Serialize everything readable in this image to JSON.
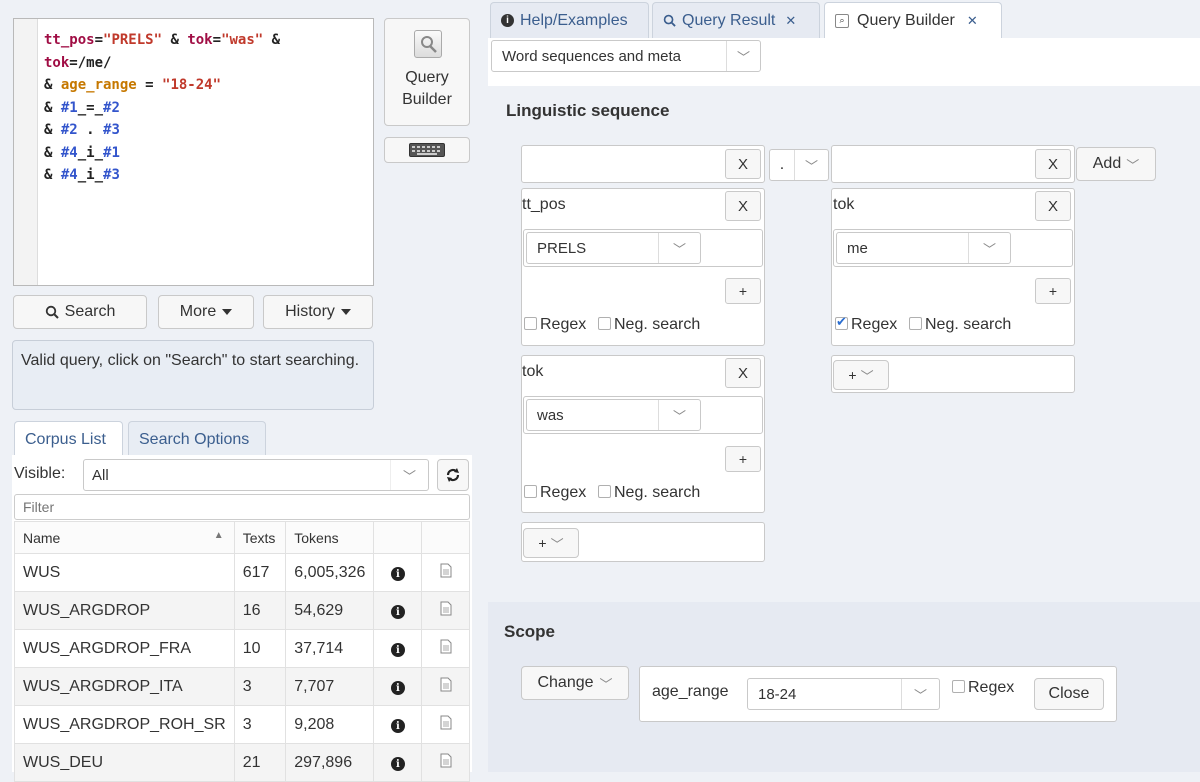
{
  "editor": {
    "lines": [
      {
        "tokens": [
          {
            "t": "tt_pos",
            "c": "k"
          },
          {
            "t": "=",
            "c": "r"
          },
          {
            "t": "\"PRELS\"",
            "c": "s"
          },
          {
            "t": " & ",
            "c": "r"
          },
          {
            "t": "tok",
            "c": "k"
          },
          {
            "t": "=",
            "c": "r"
          },
          {
            "t": "\"was\"",
            "c": "s"
          },
          {
            "t": " &",
            "c": "r"
          }
        ]
      },
      {
        "tokens": [
          {
            "t": "tok",
            "c": "k"
          },
          {
            "t": "=/me/",
            "c": "r"
          }
        ]
      },
      {
        "tokens": [
          {
            "t": "& ",
            "c": "r"
          },
          {
            "t": "age_range",
            "c": "o"
          },
          {
            "t": " = ",
            "c": "r"
          },
          {
            "t": "\"18-24\"",
            "c": "s"
          }
        ]
      },
      {
        "tokens": [
          {
            "t": "& ",
            "c": "r"
          },
          {
            "t": "#1",
            "c": "b"
          },
          {
            "t": "_=_",
            "c": "r"
          },
          {
            "t": "#2",
            "c": "b"
          }
        ]
      },
      {
        "tokens": [
          {
            "t": "& ",
            "c": "r"
          },
          {
            "t": "#2",
            "c": "b"
          },
          {
            "t": " . ",
            "c": "r"
          },
          {
            "t": "#3",
            "c": "b"
          }
        ]
      },
      {
        "tokens": [
          {
            "t": "& ",
            "c": "r"
          },
          {
            "t": "#4",
            "c": "b"
          },
          {
            "t": "_i_",
            "c": "r"
          },
          {
            "t": "#1",
            "c": "b"
          }
        ]
      },
      {
        "tokens": [
          {
            "t": "& ",
            "c": "r"
          },
          {
            "t": "#4",
            "c": "b"
          },
          {
            "t": "_i_",
            "c": "r"
          },
          {
            "t": "#3",
            "c": "b"
          }
        ]
      }
    ]
  },
  "toolbar": {
    "query_builder_line1": "Query",
    "query_builder_line2": "Builder",
    "search": "Search",
    "more": "More",
    "history": "History"
  },
  "status_message": "Valid query, click on \"Search\" to start searching.",
  "left_tabs": [
    "Corpus List",
    "Search Options"
  ],
  "corpus_list": {
    "visible_label": "Visible:",
    "visible_value": "All",
    "filter_placeholder": "Filter",
    "columns": [
      "Name",
      "Texts",
      "Tokens"
    ],
    "rows": [
      {
        "name": "WUS",
        "texts": "617",
        "tokens": "6,005,326"
      },
      {
        "name": "WUS_ARGDROP",
        "texts": "16",
        "tokens": "54,629"
      },
      {
        "name": "WUS_ARGDROP_FRA",
        "texts": "10",
        "tokens": "37,714"
      },
      {
        "name": "WUS_ARGDROP_ITA",
        "texts": "3",
        "tokens": "7,707"
      },
      {
        "name": "WUS_ARGDROP_ROH_SR",
        "texts": "3",
        "tokens": "9,208"
      },
      {
        "name": "WUS_DEU",
        "texts": "21",
        "tokens": "297,896"
      }
    ]
  },
  "right_tabs": [
    {
      "label": "Help/Examples",
      "icon": "info-icon",
      "closable": false
    },
    {
      "label": "Query Result",
      "icon": "search-icon",
      "closable": true
    },
    {
      "label": "Query Builder",
      "icon": "builder-icon",
      "closable": true
    }
  ],
  "builder_mode": "Word sequences and meta",
  "linguistic": {
    "heading": "Linguistic sequence",
    "operator": ".",
    "x": "X",
    "add": "Add",
    "plus": "+",
    "regex": "Regex",
    "neg": "Neg. search",
    "col1": {
      "conds": [
        {
          "attr": "tt_pos",
          "value": "PRELS",
          "regex": false,
          "neg": false
        },
        {
          "attr": "tok",
          "value": "was",
          "regex": false,
          "neg": false
        }
      ]
    },
    "col2": {
      "conds": [
        {
          "attr": "tok",
          "value": "me",
          "regex": true,
          "neg": false
        }
      ]
    }
  },
  "scope": {
    "heading": "Scope",
    "change": "Change",
    "attr": "age_range",
    "value": "18-24",
    "regex": "Regex",
    "close": "Close"
  }
}
